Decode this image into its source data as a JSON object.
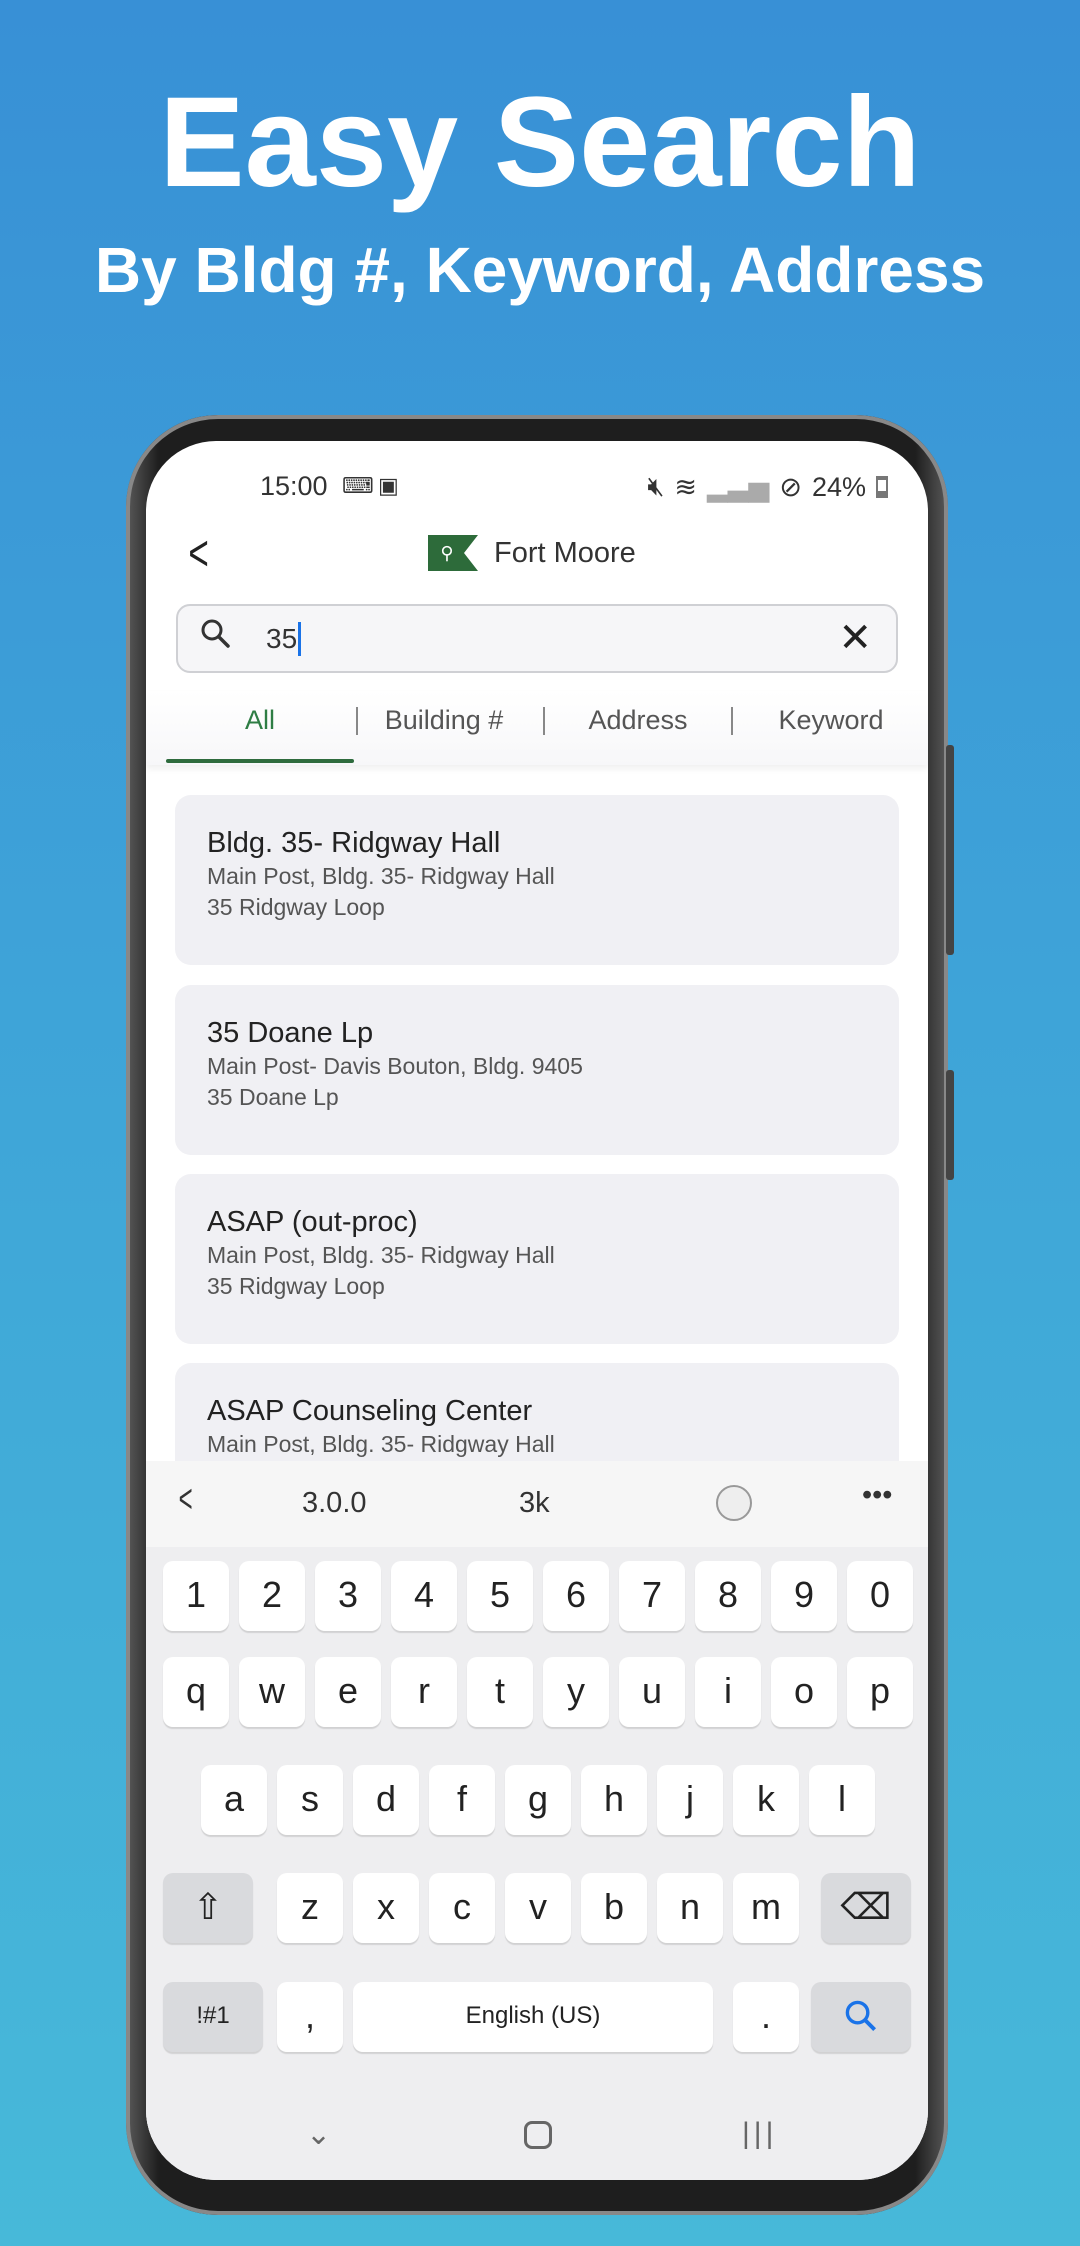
{
  "hero": {
    "title": "Easy Search",
    "subtitle": "By Bldg #, Keyword, Address"
  },
  "status": {
    "time": "15:00",
    "battery": "24%"
  },
  "header": {
    "title": "Fort Moore",
    "logo_icon": "map-pin-flag"
  },
  "search": {
    "value": "35"
  },
  "tabs": [
    {
      "label": "All",
      "active": true
    },
    {
      "label": "Building #"
    },
    {
      "label": "Address"
    },
    {
      "label": "Keyword"
    }
  ],
  "results": [
    {
      "title": "Bldg. 35- Ridgway Hall",
      "line1": "Main Post, Bldg. 35- Ridgway Hall",
      "line2": "35 Ridgway Loop"
    },
    {
      "title": "35 Doane Lp",
      "line1": "Main Post- Davis Bouton, Bldg. 9405",
      "line2": "35 Doane Lp"
    },
    {
      "title": "ASAP (out-proc)",
      "line1": "Main Post, Bldg. 35- Ridgway Hall",
      "line2": "35 Ridgway Loop"
    },
    {
      "title": "ASAP Counseling Center",
      "line1": "Main Post, Bldg. 35- Ridgway Hall",
      "line2": ""
    }
  ],
  "keyboard": {
    "suggestions": [
      "3.0.0",
      "3k"
    ],
    "row1": [
      "1",
      "2",
      "3",
      "4",
      "5",
      "6",
      "7",
      "8",
      "9",
      "0"
    ],
    "row2": [
      "q",
      "w",
      "e",
      "r",
      "t",
      "y",
      "u",
      "i",
      "o",
      "p"
    ],
    "row3": [
      "a",
      "s",
      "d",
      "f",
      "g",
      "h",
      "j",
      "k",
      "l"
    ],
    "row4": [
      "z",
      "x",
      "c",
      "v",
      "b",
      "n",
      "m"
    ],
    "symbols": "!#1",
    "comma": ",",
    "space": "English (US)",
    "period": "."
  },
  "colors": {
    "accent": "#2e7d44",
    "cursor": "#1a73e8"
  }
}
